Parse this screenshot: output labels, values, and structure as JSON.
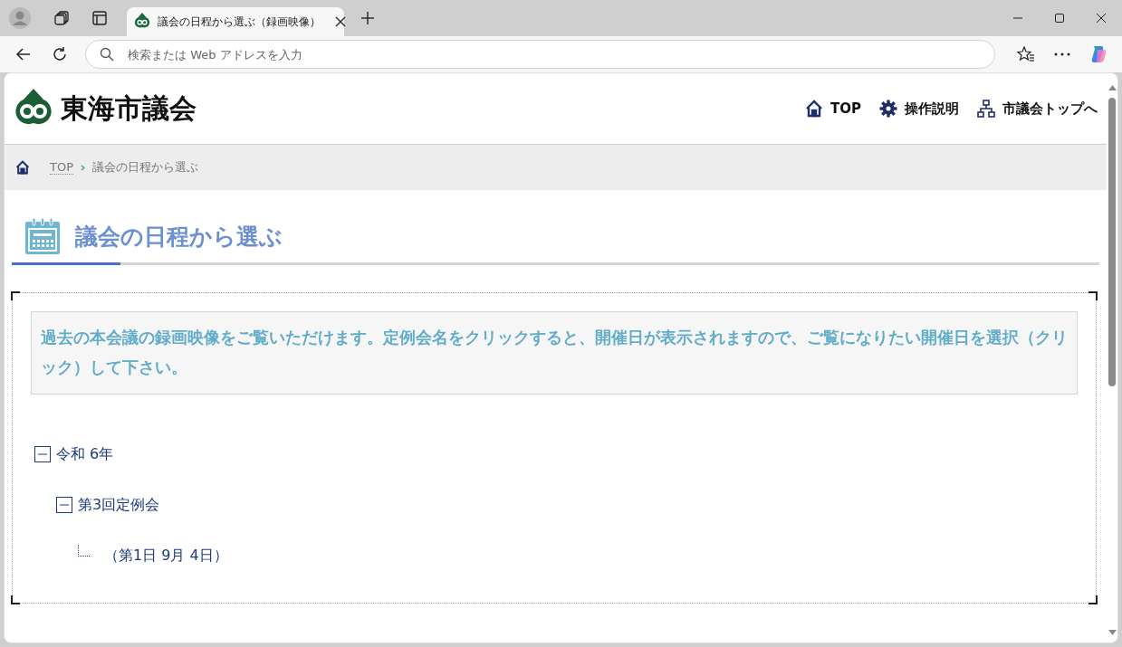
{
  "browser": {
    "tab_title": "議会の日程から選ぶ（録画映像）",
    "address_placeholder": "検索または Web アドレスを入力"
  },
  "header": {
    "logo_text": "東海市議会",
    "nav": [
      {
        "kind": "home",
        "label": "TOP"
      },
      {
        "kind": "gear",
        "label": "操作説明"
      },
      {
        "kind": "sitemap",
        "label": "市議会トップへ"
      }
    ]
  },
  "breadcrumb": {
    "items": [
      "TOP",
      "議会の日程から選ぶ"
    ]
  },
  "page_title": "議会の日程から選ぶ",
  "notice": "過去の本会議の録画映像をご覧いただけます。定例会名をクリックすると、開催日が表示されますので、ご覧になりたい開催日を選択（クリック）して下さい。",
  "tree": [
    {
      "label": "令和 6年",
      "expanded": true,
      "children": [
        {
          "label": "第3回定例会",
          "expanded": true,
          "children": [
            {
              "label": "（第1日 9月 4日）"
            }
          ]
        }
      ]
    }
  ]
}
